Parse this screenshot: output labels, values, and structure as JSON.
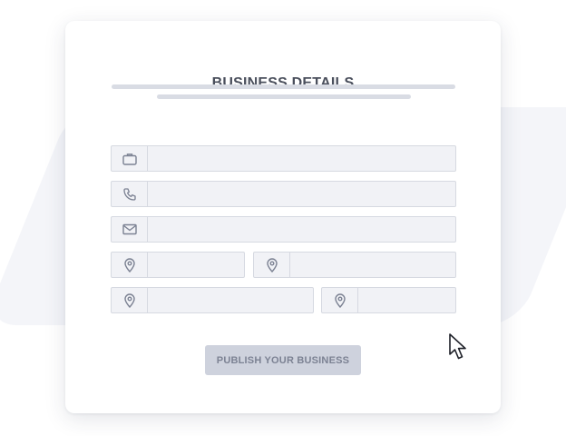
{
  "form": {
    "title": "BUSINESS DETAILS",
    "fields": [
      {
        "icon": "briefcase-icon",
        "value": "",
        "placeholder": ""
      },
      {
        "icon": "phone-icon",
        "value": "",
        "placeholder": ""
      },
      {
        "icon": "envelope-icon",
        "value": "",
        "placeholder": ""
      },
      {
        "icon": "map-pin-icon",
        "value": "",
        "placeholder": ""
      },
      {
        "icon": "map-pin-icon",
        "value": "",
        "placeholder": ""
      },
      {
        "icon": "map-pin-icon",
        "value": "",
        "placeholder": ""
      },
      {
        "icon": "map-pin-icon",
        "value": "",
        "placeholder": ""
      }
    ],
    "submit_label": "PUBLISH YOUR BUSINESS"
  },
  "colors": {
    "field_background": "#f1f2f6",
    "field_border": "#d6d9e1",
    "button_background": "#ced2dd",
    "button_text": "#7c8293",
    "title_text": "#4a4f5c"
  }
}
